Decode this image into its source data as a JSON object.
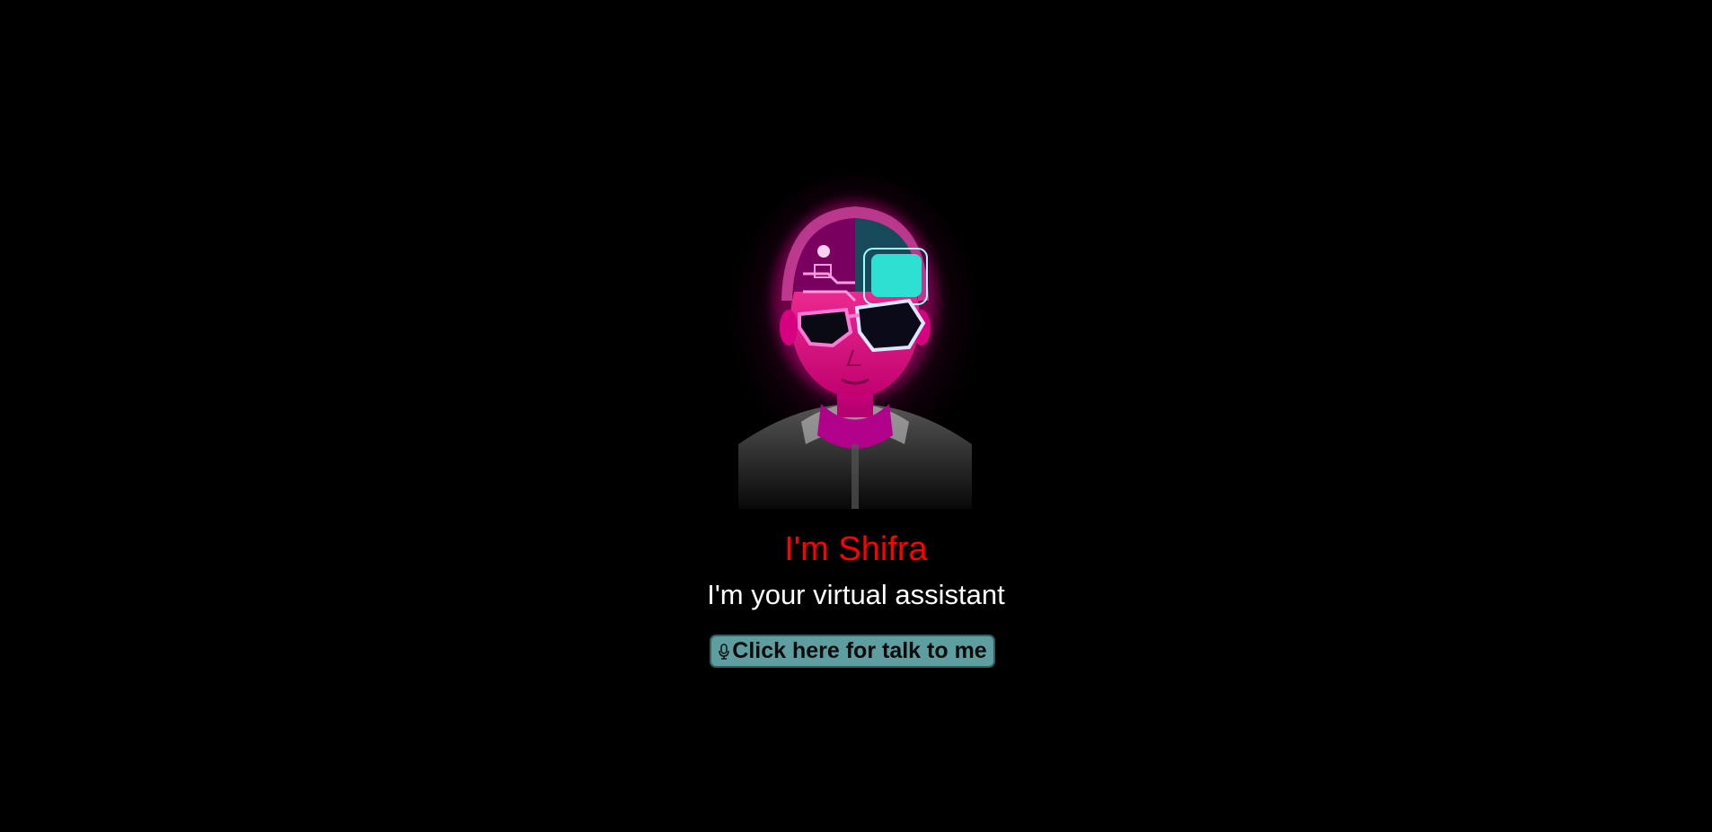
{
  "assistant": {
    "name_line": "I'm Shifra",
    "tagline": "I'm your virtual assistant"
  },
  "talk_button": {
    "label": "Click here for talk to me",
    "icon": "microphone-icon"
  },
  "avatar": {
    "icon": "cyber-assistant-avatar"
  },
  "colors": {
    "background": "#000000",
    "name": "#ff0000",
    "tagline": "#ffffff",
    "button_bg": "#5f9ea0",
    "button_text": "#0b0b0b",
    "neon_pink": "#ff1aa8",
    "neon_cyan": "#2de0d0"
  }
}
